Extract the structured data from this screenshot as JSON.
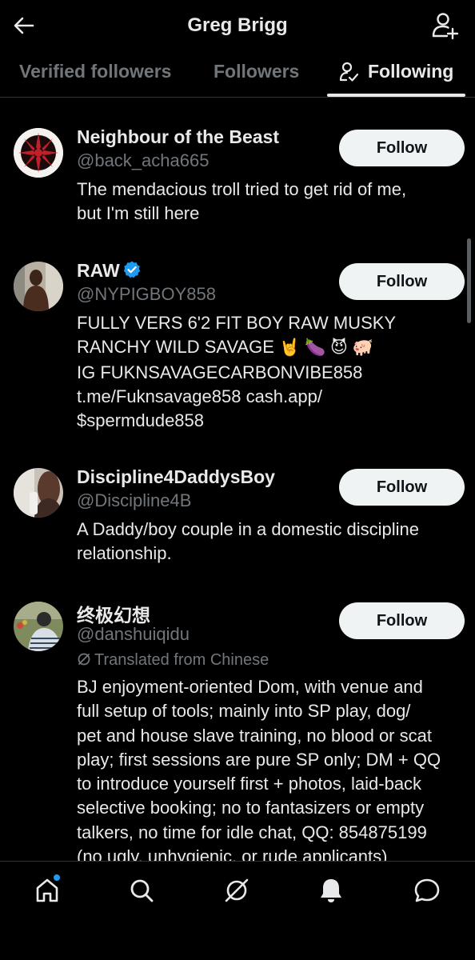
{
  "header": {
    "title": "Greg Brigg",
    "back_icon": "arrow-left-icon",
    "add_user_icon": "person-add-icon"
  },
  "tabs": [
    {
      "label": "Verified followers",
      "active": false
    },
    {
      "label": "Followers",
      "active": false
    },
    {
      "label": "Following",
      "active": true,
      "icon": "person-check-icon"
    }
  ],
  "users": [
    {
      "name": "Neighbour of the Beast",
      "handle": "@back_acha665",
      "verified": false,
      "follow_label": "Follow",
      "bio_lines": [
        "The mendacious troll tried to get rid of me,",
        "but I'm still here"
      ]
    },
    {
      "name": "RAW",
      "handle": "@NYPIGBOY858",
      "verified": true,
      "follow_label": "Follow",
      "bio_lines": [
        "FULLY VERS 6'2 FIT BOY RAW MUSKY",
        "RANCHY WILD SAVAGE",
        "IG FUKNSAVAGECARBONVIBE858",
        "t.me/Fuknsavage858 cash.app/",
        "$spermdude858"
      ],
      "bio_emojis": "🤘 🍆 😈 🐖"
    },
    {
      "name": "Discipline4DaddysBoy",
      "handle": "@Discipline4B",
      "verified": false,
      "follow_label": "Follow",
      "bio_lines": [
        "A Daddy/boy couple in a domestic discipline",
        "relationship."
      ]
    },
    {
      "name": "终极幻想",
      "handle": "@danshuiqidu",
      "verified": false,
      "follow_label": "Follow",
      "translated_label": "Translated from Chinese",
      "bio_lines": [
        "BJ enjoyment-oriented Dom, with venue and",
        "full setup of tools; mainly into SP play, dog/",
        "pet and house slave training, no blood or scat",
        "play; first sessions are pure SP only; DM + QQ",
        "to introduce yourself first + photos, laid-back",
        "selective booking; no to fantasizers or empty",
        "talkers, no time for idle chat, QQ: 854875199",
        "(no ugly, unhygienic, or rude applicants)"
      ]
    }
  ],
  "bottom_nav": {
    "items": [
      "home-icon",
      "search-icon",
      "grok-icon",
      "notifications-icon",
      "messages-icon"
    ],
    "accent": "#1d9bf0"
  },
  "colors": {
    "background": "#000000",
    "text": "#e7e9ea",
    "muted": "#71767b",
    "button": "#eff3f4",
    "verified": "#1d9bf0"
  }
}
